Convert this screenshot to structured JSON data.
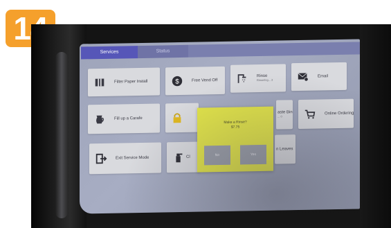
{
  "step_badge": "14",
  "tabs": [
    {
      "label": "Services"
    },
    {
      "label": "Status"
    }
  ],
  "tiles": {
    "filter_paper": {
      "label": "Filter Paper Install"
    },
    "free_vend": {
      "label": "Free Vend Off"
    },
    "rinse": {
      "label": "Rinse",
      "sub": "Rinse/ing... 2"
    },
    "email": {
      "label": "Email"
    },
    "fill_carafe": {
      "label": "Fill up a Carafe"
    },
    "lock": {
      "label": ""
    },
    "waste_bin": {
      "label": "aste Bin",
      "sub": "... 0"
    },
    "online_ordering": {
      "label": "Online Ordering"
    },
    "exit_service": {
      "label": "Exit Service Mode"
    },
    "clean": {
      "label": "Cl"
    },
    "leaves": {
      "label": "n Leaves"
    }
  },
  "dialog": {
    "title": "Make a Rinse?",
    "price": "$7.75",
    "no_label": "No",
    "yes_label": "Yes"
  },
  "colors": {
    "badge": "#f5a02c",
    "tab_active": "#5656b8",
    "dialog": "#e1e34a",
    "screen": "#a0a6bc"
  }
}
